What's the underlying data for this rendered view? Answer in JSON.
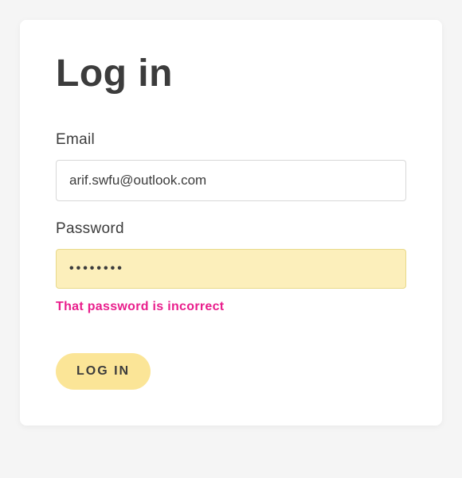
{
  "form": {
    "title": "Log in",
    "email": {
      "label": "Email",
      "value": "arif.swfu@outlook.com"
    },
    "password": {
      "label": "Password",
      "value": "••••••••",
      "error": "That password is incorrect"
    },
    "submit_label": "LOG IN"
  }
}
